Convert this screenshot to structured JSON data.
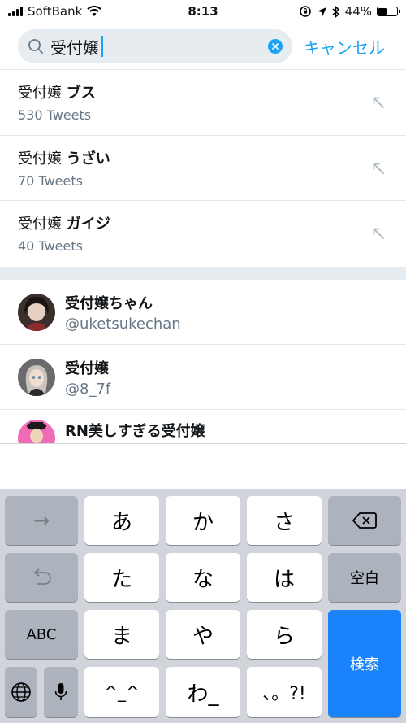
{
  "status_bar": {
    "carrier": "SoftBank",
    "time": "8:13",
    "battery": "44%",
    "battery_level": 0.44
  },
  "search": {
    "query": "受付嬢",
    "cancel_label": "キャンセル"
  },
  "suggestions": [
    {
      "prefix": "受付嬢 ",
      "suffix": "ブス",
      "count": "530 Tweets"
    },
    {
      "prefix": "受付嬢 ",
      "suffix": "うざい",
      "count": "70 Tweets"
    },
    {
      "prefix": "受付嬢 ",
      "suffix": "ガイジ",
      "count": "40 Tweets"
    }
  ],
  "users": [
    {
      "name": "受付嬢ちゃん",
      "handle": "@uketsukechan"
    },
    {
      "name": "受付嬢",
      "handle": "@8_7f"
    },
    {
      "name": "RN美しすぎる受付嬢",
      "handle": ""
    }
  ],
  "keyboard": {
    "row1": {
      "left": "→",
      "k1": "あ",
      "k2": "か",
      "k3": "さ"
    },
    "row2": {
      "k1": "た",
      "k2": "な",
      "k3": "は",
      "right": "空白"
    },
    "row3": {
      "left": "ABC",
      "k1": "ま",
      "k2": "や",
      "k3": "ら"
    },
    "row4": {
      "k1": "^_^",
      "k2": "わ_",
      "k3": "、。?!"
    },
    "search_label": "検索"
  },
  "colors": {
    "accent": "#1da1f2",
    "search_key": "#1a82fb"
  }
}
